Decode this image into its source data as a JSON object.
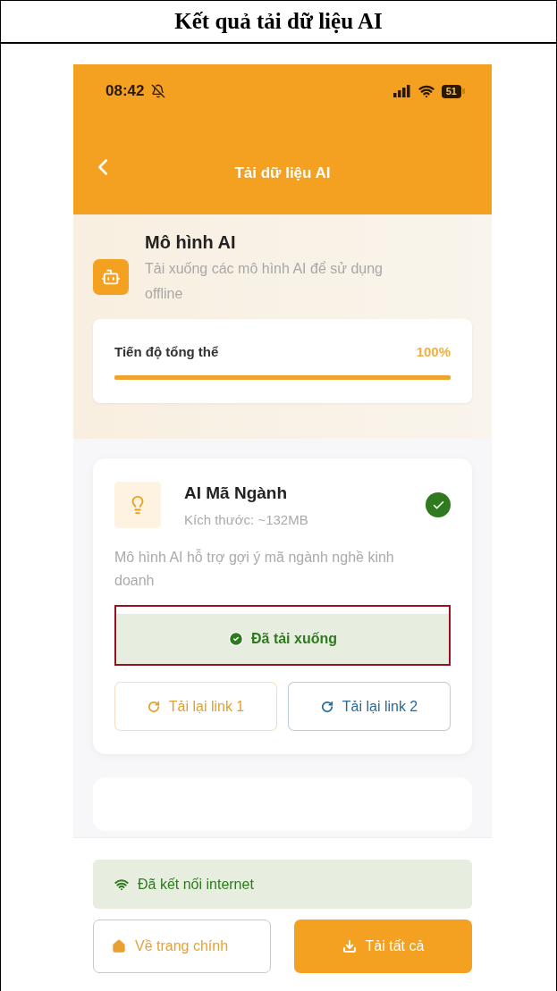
{
  "document": {
    "title": "Kết quả tải dữ liệu AI"
  },
  "status_bar": {
    "time": "08:42",
    "battery": "51"
  },
  "nav": {
    "title": "Tải dữ liệu AI"
  },
  "section": {
    "title": "Mô hình AI",
    "subtitle": "Tải xuống các mô hình AI để sử dụng offline"
  },
  "progress": {
    "label": "Tiến độ tổng thể",
    "value": "100%",
    "level": 1
  },
  "models": [
    {
      "name": "AI Mã Ngành",
      "size": "Kích thước: ~132MB",
      "description": "Mô hình AI hỗ trợ gợi ý mã ngành nghề kinh doanh",
      "downloaded": true,
      "status": "Đã tải xuống",
      "highlighted": true,
      "actions": [
        "Tải lại link 1",
        "Tải lại link 2"
      ]
    }
  ],
  "connection": {
    "label": "Đã kết nối internet",
    "online": true
  },
  "buttons": [
    {
      "label": "Về trang chính",
      "kind": "outline"
    },
    {
      "label": "Tải tất cả",
      "kind": "primary"
    }
  ]
}
